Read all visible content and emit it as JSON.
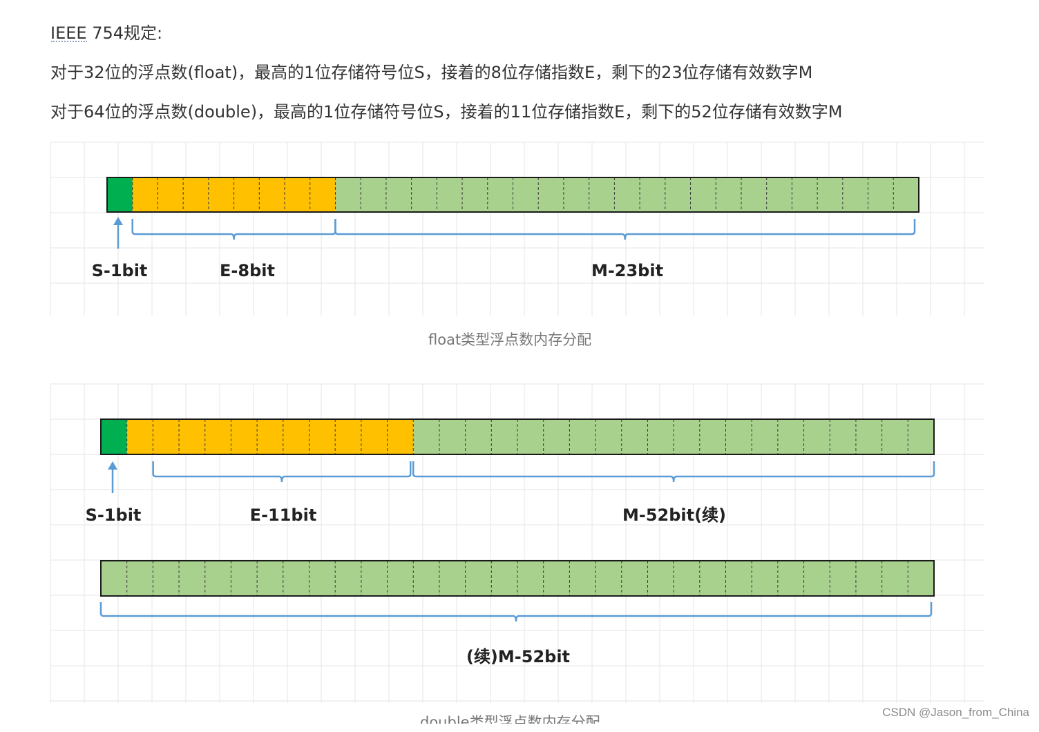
{
  "header": {
    "title": "IEEE 754规定:",
    "line_float": "对于32位的浮点数(float)，最高的1位存储符号位S，接着的8位存储指数E，剩下的23位存储有效数字M",
    "line_double": "对于64位的浮点数(double)，最高的1位存储符号位S，接着的11位存储指数E，剩下的52位存储有效数字M"
  },
  "float_diagram": {
    "sign_bits": 1,
    "exponent_bits": 8,
    "mantissa_bits": 23,
    "label_sign": "S-1bit",
    "label_exponent": "E-8bit",
    "label_mantissa": "M-23bit",
    "caption": "float类型浮点数内存分配"
  },
  "double_diagram": {
    "sign_bits": 1,
    "exponent_bits": 11,
    "mantissa_bits_row1": 20,
    "mantissa_bits_row2": 32,
    "label_sign": "S-1bit",
    "label_exponent": "E-11bit",
    "label_mantissa_cont": "M-52bit(续)",
    "label_mantissa_cont2": "(续)M-52bit",
    "caption": "double类型浮点数内存分配"
  },
  "colors": {
    "sign": "#00b050",
    "exponent": "#ffc000",
    "mantissa": "#a9d18e",
    "bracket": "#5b9bd5",
    "grid": "#e6e6e6"
  },
  "watermark": "CSDN @Jason_from_China"
}
